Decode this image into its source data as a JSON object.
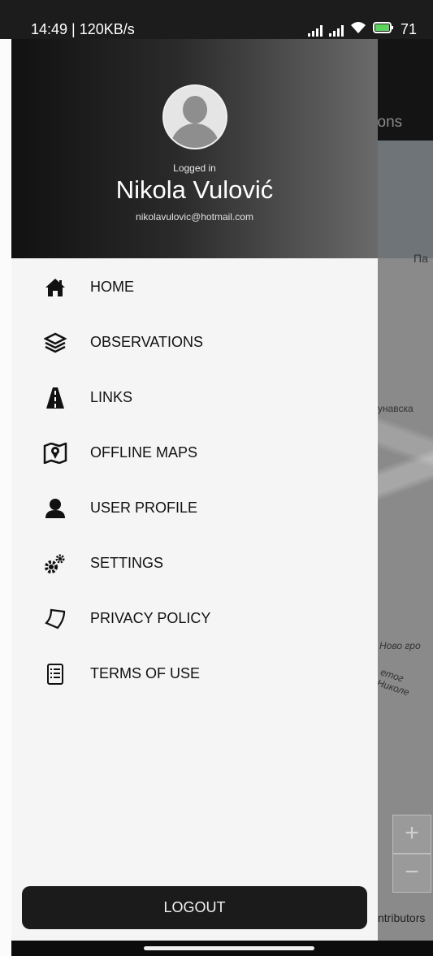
{
  "status_bar": {
    "time_info": "14:49 | 120KB/s",
    "battery": "71"
  },
  "background": {
    "tab_fragment": "tions",
    "map_labels": [
      "Па",
      "унавска",
      "Ново гро",
      "етог Николе"
    ],
    "zoom_in": "+",
    "zoom_out": "−",
    "attribution": "ntributors"
  },
  "drawer": {
    "logged_in_label": "Logged in",
    "user_name": "Nikola Vulović",
    "user_email": "nikolavulovic@hotmail.com",
    "menu": [
      {
        "label": "HOME",
        "icon": "home-icon"
      },
      {
        "label": "OBSERVATIONS",
        "icon": "layers-icon"
      },
      {
        "label": "LINKS",
        "icon": "road-icon"
      },
      {
        "label": "OFFLINE MAPS",
        "icon": "map-pin-icon"
      },
      {
        "label": "USER PROFILE",
        "icon": "user-icon"
      },
      {
        "label": "SETTINGS",
        "icon": "gears-icon"
      },
      {
        "label": "PRIVACY POLICY",
        "icon": "shield-outline-icon"
      },
      {
        "label": "TERMS OF USE",
        "icon": "document-list-icon"
      }
    ],
    "logout_label": "LOGOUT"
  }
}
